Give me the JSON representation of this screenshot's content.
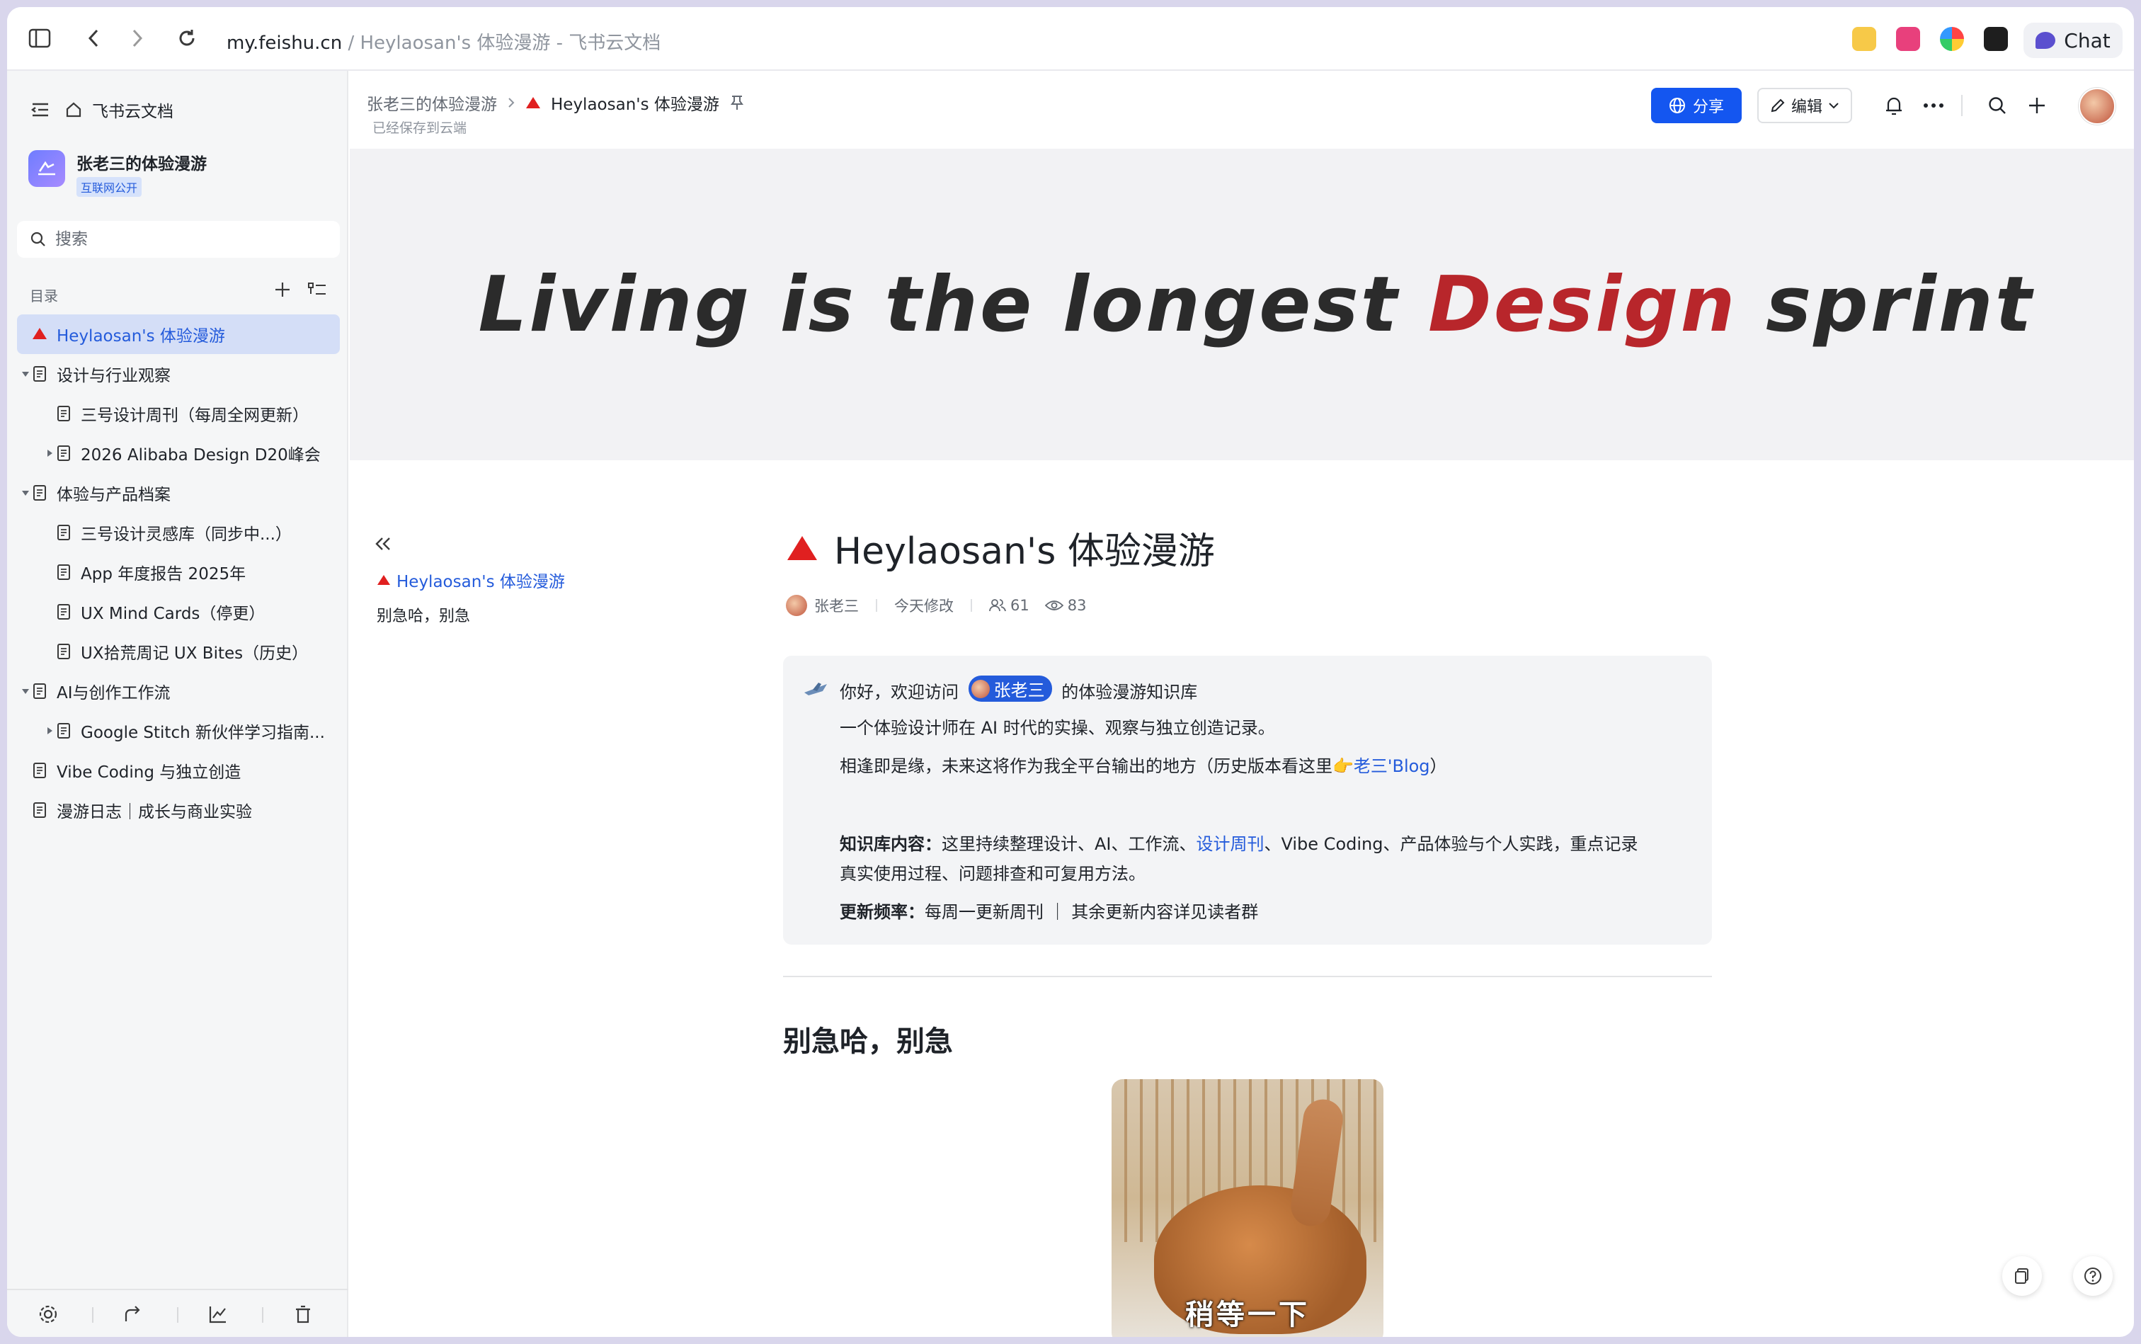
{
  "browser": {
    "url_domain": "my.feishu.cn",
    "url_separator": "/",
    "url_title": "Heylaosan's 体验漫游 - 飞书云文档",
    "chat_label": "Chat"
  },
  "sidebar": {
    "home_label": "飞书云文档",
    "space_title": "张老三的体验漫游",
    "space_badge": "互联网公开",
    "search_placeholder": "搜索",
    "toc_label": "目录",
    "items": [
      {
        "label": "Heylaosan's 体验漫游",
        "level": 0,
        "active": true,
        "icon": "red-triangle"
      },
      {
        "label": "设计与行业观察",
        "level": 0,
        "expanded": true
      },
      {
        "label": "三号设计周刊（每周全网更新）",
        "level": 1
      },
      {
        "label": "2026 Alibaba Design D20峰会",
        "level": 1,
        "collapsed": true
      },
      {
        "label": "体验与产品档案",
        "level": 0,
        "expanded": true
      },
      {
        "label": "三号设计灵感库（同步中...）",
        "level": 1
      },
      {
        "label": "App 年度报告 2025年",
        "level": 1
      },
      {
        "label": "UX Mind Cards（停更）",
        "level": 1
      },
      {
        "label": "UX拾荒周记 UX Bites（历史）",
        "level": 1
      },
      {
        "label": "AI与创作工作流",
        "level": 0,
        "expanded": true
      },
      {
        "label": "Google Stitch 新伙伴学习指南...",
        "level": 1,
        "collapsed": true
      },
      {
        "label": "Vibe Coding 与独立创造",
        "level": 0
      },
      {
        "label": "漫游日志｜成长与商业实验",
        "level": 0
      }
    ]
  },
  "header": {
    "crumb_parent": "张老三的体验漫游",
    "crumb_current": "Heylaosan's 体验漫游",
    "saved_status": "已经保存到云端",
    "share_label": "分享",
    "edit_label": "编辑"
  },
  "cover": {
    "text_before": "Living is the longest ",
    "text_highlight": "Design",
    "text_after": " sprint"
  },
  "outline": {
    "item1": "Heylaosan's 体验漫游",
    "item2": "别急哈，别急"
  },
  "doc": {
    "title": "Heylaosan's 体验漫游",
    "author": "张老三",
    "modified": "今天修改",
    "collaborators": "61",
    "views": "83",
    "callout": {
      "line1_pre": "你好，欢迎访问",
      "mention": "张老三",
      "line1_post": "的体验漫游知识库",
      "line2": "一个体验设计师在 AI 时代的实操、观察与独立创造记录。",
      "line3_pre": "相逢即是缘，未来这将作为我全平台输出的地方（历史版本看这里👉",
      "line3_link": "老三'Blog",
      "line3_post": "）",
      "content_label": "知识库内容：",
      "content_pre": "这里持续整理设计、AI、工作流、",
      "content_link": "设计周刊",
      "content_post": "、Vibe Coding、产品体验与个人实践，重点记录",
      "content_line2": "真实使用过程、问题排查和可复用方法。",
      "freq_label": "更新频率：",
      "freq_text": "每周一更新周刊 ｜ 其余更新内容详见读者群"
    },
    "heading2": "别急哈，别急",
    "image_caption": "稍等一下"
  },
  "colors": {
    "accent": "#1456f0",
    "link": "#245bdb",
    "cover_red": "#b8262b",
    "sidebar_bg": "#f5f6f7"
  }
}
